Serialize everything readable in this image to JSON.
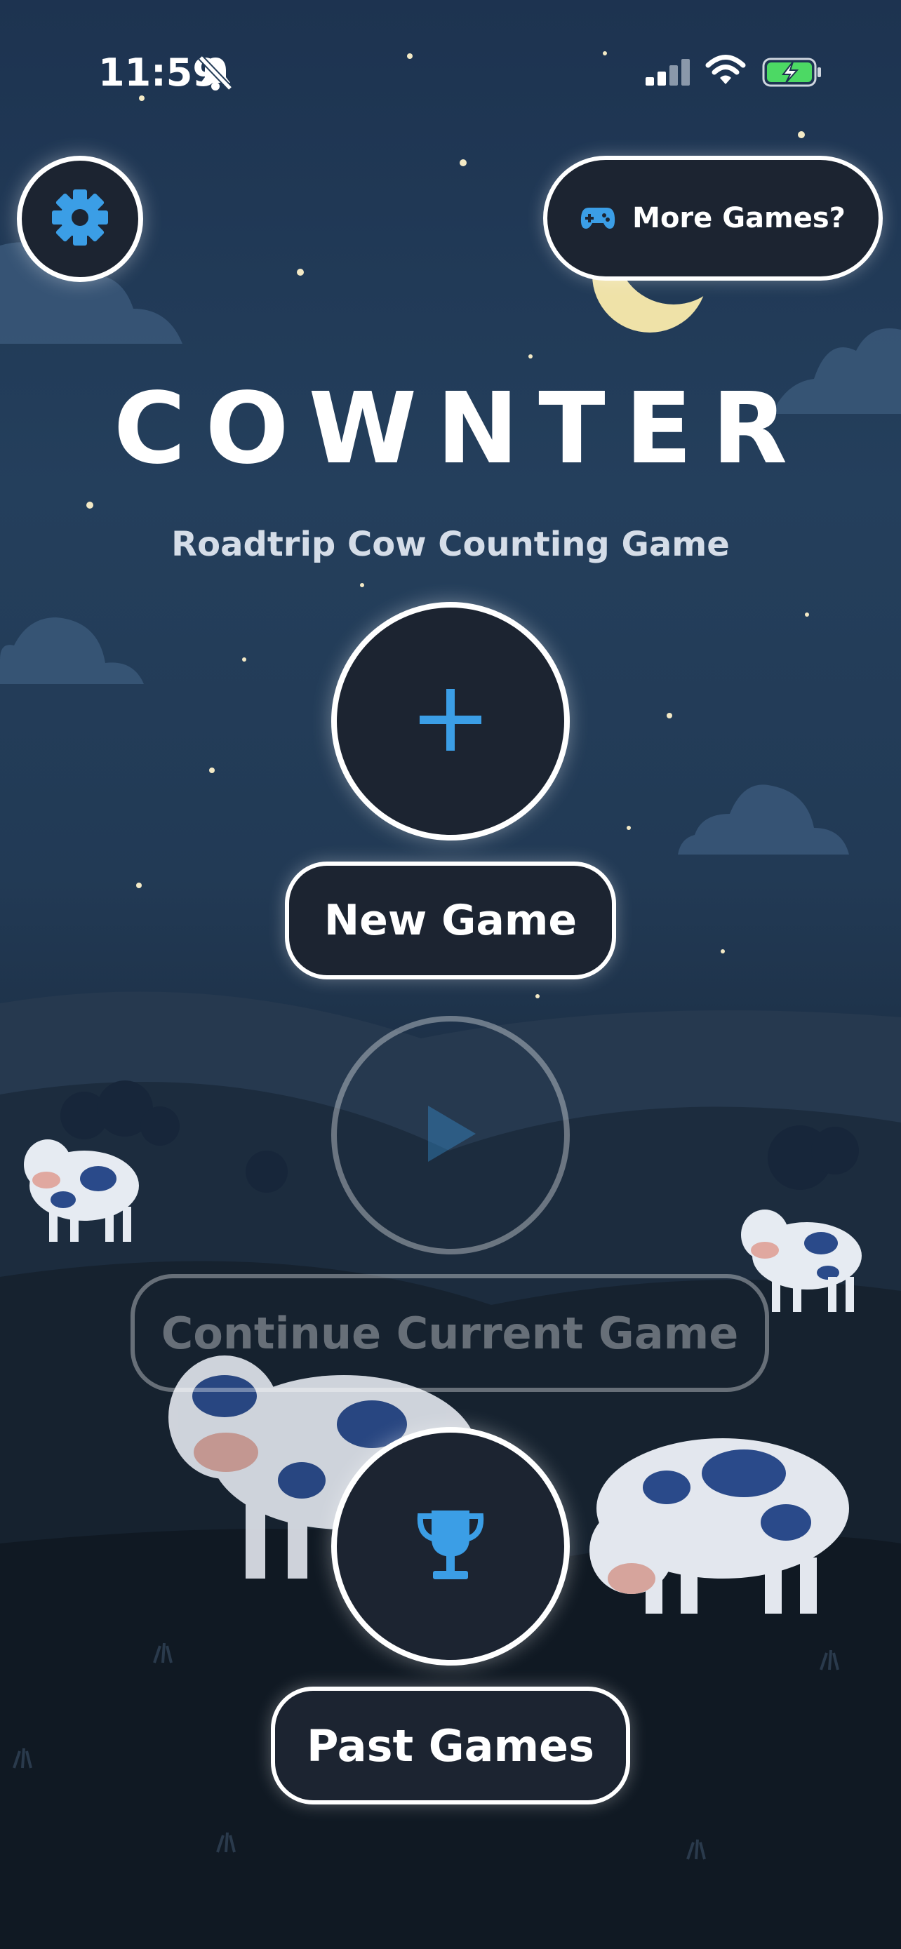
{
  "status_bar": {
    "time": "11:59"
  },
  "header": {
    "more_games_label": "More Games?"
  },
  "app": {
    "title": "COWNTER",
    "subtitle": "Roadtrip Cow Counting Game"
  },
  "actions": {
    "new_game_label": "New Game",
    "continue_label": "Continue Current Game",
    "past_games_label": "Past Games"
  },
  "colors": {
    "accent": "#3b9ee6",
    "button_bg": "#1c2431",
    "battery": "#4cd964"
  },
  "icons": {
    "settings": "gear-icon",
    "more_games": "gamepad-icon",
    "new_game": "plus-icon",
    "continue": "play-icon",
    "past_games": "trophy-icon"
  }
}
